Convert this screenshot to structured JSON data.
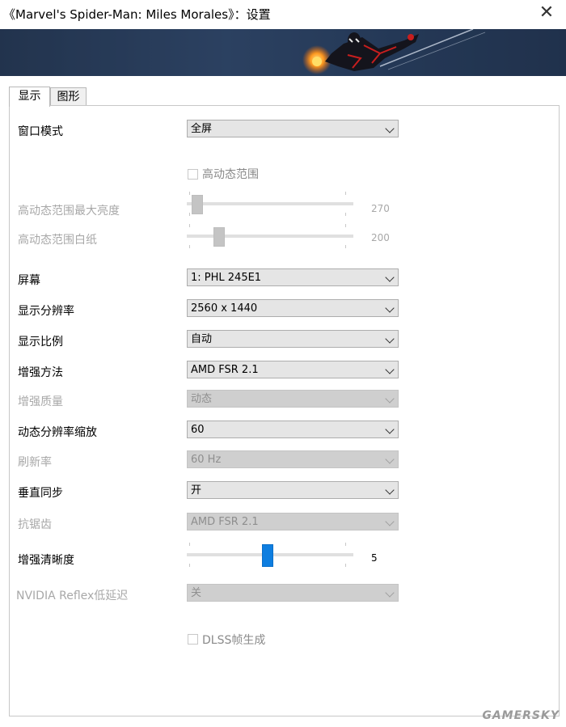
{
  "window": {
    "title": "《Marvel's Spider-Man: Miles Morales》：设置",
    "close_glyph": "✕"
  },
  "tabs": [
    {
      "label": "显示",
      "active": true
    },
    {
      "label": "图形",
      "active": false
    }
  ],
  "settings": {
    "window_mode": {
      "label": "窗口模式",
      "value": "全屏"
    },
    "hdr": {
      "label": "高动态范围",
      "checked": false
    },
    "hdr_max_brightness": {
      "label": "高动态范围最大亮度",
      "value": "270"
    },
    "hdr_paper_white": {
      "label": "高动态范围白纸",
      "value": "200"
    },
    "screen": {
      "label": "屏幕",
      "value": "1: PHL 245E1"
    },
    "resolution": {
      "label": "显示分辨率",
      "value": "2560 x 1440"
    },
    "aspect_ratio": {
      "label": "显示比例",
      "value": "自动"
    },
    "upscale_method": {
      "label": "增强方法",
      "value": "AMD FSR 2.1"
    },
    "upscale_quality": {
      "label": "增强质量",
      "value": "动态"
    },
    "dynamic_res_scaling": {
      "label": "动态分辨率缩放",
      "value": "60"
    },
    "refresh_rate": {
      "label": "刷新率",
      "value": "60 Hz"
    },
    "vsync": {
      "label": "垂直同步",
      "value": "开"
    },
    "anti_aliasing": {
      "label": "抗锯齿",
      "value": "AMD FSR 2.1"
    },
    "sharpness": {
      "label": "增强清晰度",
      "value": "5"
    },
    "reflex": {
      "label": "NVIDIA Reflex低延迟",
      "value": "关"
    },
    "dlss_frame_gen": {
      "label": "DLSS帧生成",
      "checked": false
    }
  },
  "watermark": "GAMERSKY",
  "colors": {
    "accent": "#0e7ee0",
    "disabled_text": "#a8a8a8"
  }
}
